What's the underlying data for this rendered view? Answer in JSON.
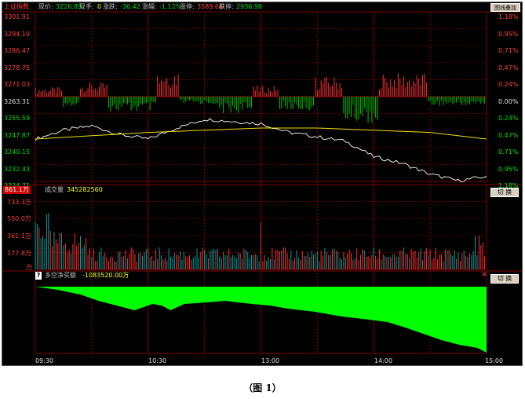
{
  "header": {
    "index_name": "上证指数",
    "price_label": "现价:",
    "price": "3226.89",
    "hand_label": "现手:",
    "hand": "0",
    "change_label": "涨跌:",
    "change": "-36.42",
    "pct_label": "涨幅:",
    "pct": "-1.12%",
    "limit_up_label": "涨停:",
    "limit_up": "3589.64",
    "limit_down_label": "跌停:",
    "limit_down": "2936.98",
    "overlay_button": "图线叠加"
  },
  "price_panel": {
    "left_labels": [
      "3301.91",
      "3294.19",
      "3286.47",
      "3278.75",
      "3271.03",
      "3263.31",
      "3255.59",
      "3247.87",
      "3240.15",
      "3232.43",
      "3224.71"
    ],
    "right_labels": [
      "1.18%",
      "0.95%",
      "0.71%",
      "0.47%",
      "0.24%",
      "0.00%",
      "0.24%",
      "0.47%",
      "0.71%",
      "0.95%",
      "1.18%"
    ]
  },
  "volume_panel": {
    "title": "成交量",
    "total": "345282560",
    "max_badge": "861.1万",
    "labels": [
      "733.3万",
      "550.0万",
      "361.1万",
      "177.8万",
      "万"
    ],
    "switch_button": "切 换"
  },
  "net_panel": {
    "question_icon": "?",
    "title": "多空净买额",
    "value": "-1083520.00万",
    "close_glyph": "×",
    "switch_button": "切 换"
  },
  "time_axis": [
    "09:30",
    "10:30",
    "13:00",
    "14:00",
    "15:00"
  ],
  "caption": "（图 1）",
  "colors": {
    "up": "#ff3030",
    "down": "#00c000",
    "price_line": "#ffffff",
    "avg_line": "#e8e000",
    "grid": "#800000",
    "net_fill": "#00ff00",
    "volume": "#00a0a0"
  },
  "chart_data": {
    "type": "line",
    "series": [
      {
        "x": [
          "09:30",
          "09:45",
          "10:00",
          "10:15",
          "10:30",
          "10:45",
          "11:00",
          "11:15",
          "11:30",
          "13:15",
          "13:30",
          "13:45",
          "14:00",
          "14:15",
          "14:30",
          "14:45",
          "15:00"
        ],
        "values": [
          3244,
          3248,
          3250,
          3246,
          3244,
          3249,
          3253,
          3252,
          3251,
          3247,
          3245,
          3243,
          3236,
          3233,
          3228,
          3225,
          3227
        ]
      },
      {
        "x": [
          "09:30",
          "10:30",
          "11:30",
          "13:30",
          "14:00",
          "14:30",
          "15:00"
        ],
        "values": [
          3244,
          3247,
          3249,
          3249,
          3248,
          3247,
          3244
        ]
      }
    ],
    "ylim": [
      3224.71,
      3301.91
    ],
    "grid": true
  }
}
